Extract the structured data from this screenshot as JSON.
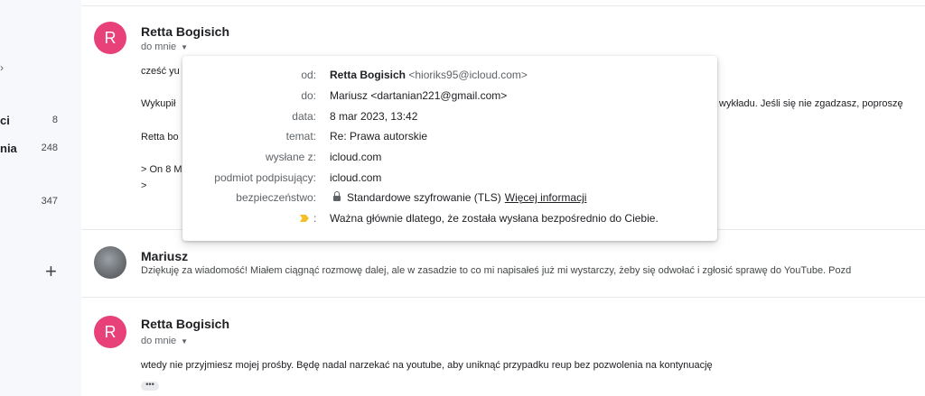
{
  "sidebar": {
    "items": [
      {
        "label": "ci",
        "count": "8"
      },
      {
        "label": "nia",
        "count": "248"
      },
      {
        "label": "",
        "count": "347"
      }
    ]
  },
  "messages": [
    {
      "sender": "Retta Bogisich",
      "avatar_letter": "R",
      "to_label": "do mnie",
      "body_lines": [
        "cześć yu",
        "Wykupił",
        "Retta bo",
        "> On 8 M",
        ">"
      ],
      "body_right_text": "wykładu.  Jeśli się nie zgadzasz, poproszę"
    },
    {
      "sender": "Mariusz",
      "snippet": "Dziękuję za wiadomość! Miałem ciągnąć rozmowę dalej, ale w zasadzie to co mi napisałeś już mi wystarczy, żeby się odwołać i zgłosić sprawę do YouTube. Pozd"
    },
    {
      "sender": "Retta Bogisich",
      "avatar_letter": "R",
      "to_label": "do mnie",
      "body": "wtedy nie przyjmiesz mojej prośby.  Będę nadal narzekać na youtube, aby uniknąć przypadku reup bez pozwolenia na kontynuację",
      "ellipsis": "•••"
    }
  ],
  "details_popup": {
    "from": {
      "label": "od:",
      "name": "Retta Bogisich",
      "email": "<hioriks95@icloud.com>"
    },
    "to": {
      "label": "do:",
      "value": "Mariusz <dartanian221@gmail.com>"
    },
    "date": {
      "label": "data:",
      "value": "8 mar 2023, 13:42"
    },
    "subject": {
      "label": "temat:",
      "value": "Re: Prawa autorskie"
    },
    "mailed_by": {
      "label": "wysłane z:",
      "value": "icloud.com"
    },
    "signed_by": {
      "label": "podmiot podpisujący:",
      "value": "icloud.com"
    },
    "security": {
      "label": "bezpieczeństwo:",
      "value": "Standardowe szyfrowanie (TLS)",
      "link": "Więcej informacji"
    },
    "importance": {
      "value": "Ważna głównie dlatego, że została wysłana bezpośrednio do Ciebie.",
      "colon": ":"
    }
  },
  "colors": {
    "avatar": "#e8417a",
    "importance_marker": "#f6bf26",
    "background": "#f6f8fc"
  }
}
